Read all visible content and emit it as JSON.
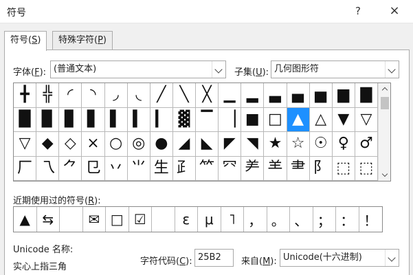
{
  "window": {
    "title": "符号",
    "help": "?",
    "close": "×"
  },
  "tabs": [
    {
      "pre": "符号(",
      "key": "S",
      "post": ")"
    },
    {
      "pre": "特殊字符(",
      "key": "P",
      "post": ")"
    }
  ],
  "font": {
    "pre": "字体(",
    "key": "F",
    "post": "):",
    "value": "(普通文本)"
  },
  "subset": {
    "pre": "子集(",
    "key": "U",
    "post": "):",
    "value": "几何图形符"
  },
  "grid": [
    "╋",
    "╬",
    "◜",
    "◝",
    "◞",
    "◟",
    "╱",
    "╲",
    "╳",
    "▁",
    "▂",
    "▃",
    "▄",
    "▅",
    "▆",
    "▇",
    "█",
    "▉",
    "▊",
    "▋",
    "▌",
    "▍",
    "▎",
    "▓",
    "▔",
    "▕",
    "■",
    "□",
    "▲",
    "△",
    "▼",
    "▽",
    "▽",
    "◆",
    "◇",
    "×",
    "○",
    "◎",
    "●",
    "◢",
    "◣",
    "◤",
    "◥",
    "★",
    "☆",
    "☉",
    "♀",
    "♂",
    "厂",
    "乁",
    "⺈",
    "㔾",
    "丷",
    "⺌",
    "生",
    "⺪",
    "⺮",
    "⺳",
    "⺶",
    "⺷",
    "⺻",
    "⻖",
    "⬚",
    "⬚"
  ],
  "selected_index": 28,
  "recent": {
    "pre": "近期使用过的符号(",
    "key": "R",
    "post": "):",
    "symbols": [
      "▲",
      "⇆",
      "",
      "✉",
      "□",
      "☑",
      "",
      "ε",
      "μ",
      "˥",
      "，",
      "。",
      "、",
      "；",
      "：",
      "！"
    ]
  },
  "unicode_name": {
    "label": "Unicode 名称:",
    "value": "实心上指三角"
  },
  "char_code": {
    "pre": "字符代码(",
    "key": "C",
    "post": "):",
    "value": "25B2"
  },
  "from": {
    "pre": "来自(",
    "key": "M",
    "post": "):",
    "value": "Unicode(十六进制)"
  }
}
